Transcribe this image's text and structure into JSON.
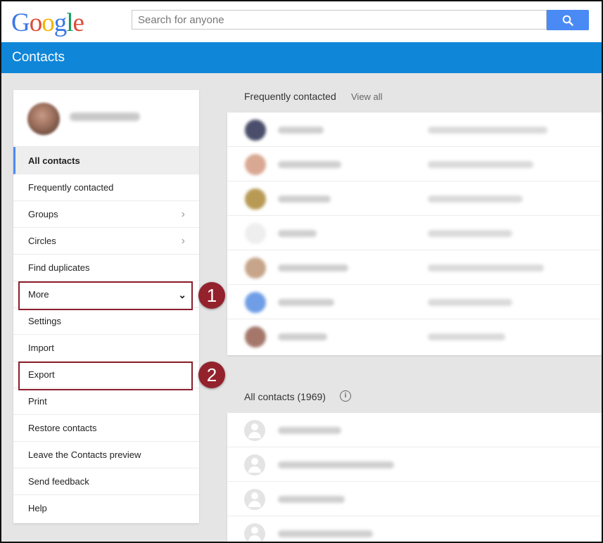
{
  "header": {
    "logo": "Google",
    "search_placeholder": "Search for anyone",
    "app_title": "Contacts"
  },
  "sidebar": {
    "items": [
      {
        "label": "All contacts"
      },
      {
        "label": "Frequently contacted"
      },
      {
        "label": "Groups"
      },
      {
        "label": "Circles"
      },
      {
        "label": "Find duplicates"
      },
      {
        "label": "More"
      },
      {
        "label": "Settings"
      },
      {
        "label": "Import"
      },
      {
        "label": "Export"
      },
      {
        "label": "Print"
      },
      {
        "label": "Restore contacts"
      },
      {
        "label": "Leave the Contacts preview"
      },
      {
        "label": "Send feedback"
      },
      {
        "label": "Help"
      }
    ]
  },
  "annotations": {
    "marker_1": "1",
    "marker_2": "2",
    "color": "#93222d"
  },
  "main": {
    "frequent_title": "Frequently contacted",
    "view_all": "View all",
    "all_title": "All contacts (1969)",
    "icons": [
      "search-icon",
      "info-icon",
      "chevron-right-icon",
      "chevron-down-icon"
    ]
  },
  "colors": {
    "accent_blue": "#0f86d8",
    "search_button": "#4a8af4"
  }
}
